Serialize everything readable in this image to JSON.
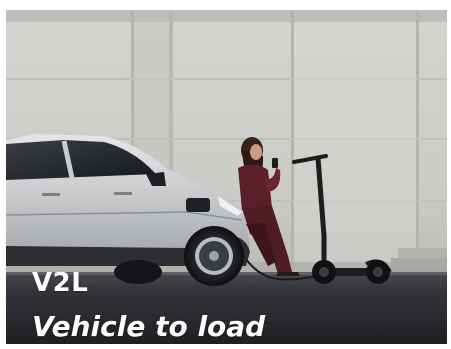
{
  "image": {
    "subject": "electric-car-charging-scooter-photo",
    "colors": {
      "wall": "#cfcfca",
      "car_body": "#c9cbcc",
      "scooter": "#1d1d1f",
      "outfit": "#5a1f2a",
      "ground": "#2b2c30",
      "caption_text": "#ffffff"
    }
  },
  "caption": {
    "code": "V2L",
    "subtitle": "Vehicle to load"
  }
}
